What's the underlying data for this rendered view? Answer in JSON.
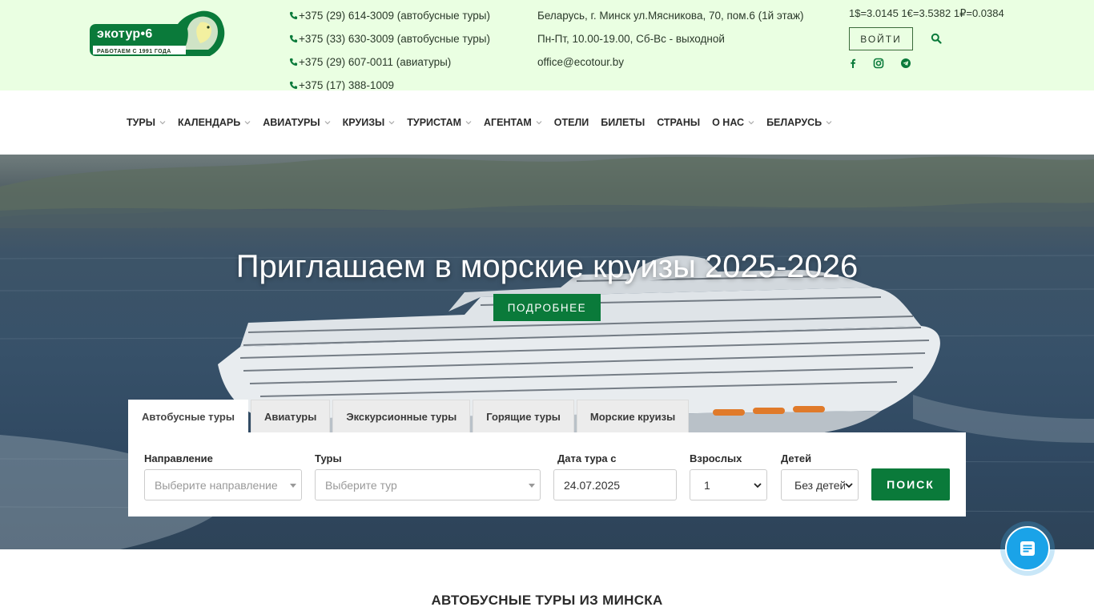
{
  "logo": {
    "name": "экотур•6",
    "slogan": "РАБОТАЕМ С 1991 ГОДА"
  },
  "phones": [
    "+375 (29) 614-3009 (автобусные туры)",
    "+375 (33) 630-3009 (автобусные туры)",
    "+375 (29) 607-0011 (авиатуры)",
    "+375 (17) 388-1009"
  ],
  "contacts": {
    "address": "Беларусь, г. Минск ул.Мясникова, 70, пом.6 (1й этаж)",
    "hours": "Пн-Пт, 10.00-19.00, Сб-Вс - выходной",
    "email": "office@ecotour.by"
  },
  "rates": "1$=3.0145 1€=3.5382 1₽=0.0384",
  "header": {
    "login_label": "ВОЙТИ",
    "icons": [
      "search-icon",
      "facebook-icon",
      "instagram-icon",
      "telegram-icon"
    ]
  },
  "nav": {
    "items": [
      {
        "label": "ТУРЫ",
        "dropdown": true
      },
      {
        "label": "КАЛЕНДАРЬ",
        "dropdown": true
      },
      {
        "label": "АВИАТУРЫ",
        "dropdown": true
      },
      {
        "label": "КРУИЗЫ",
        "dropdown": true
      },
      {
        "label": "ТУРИСТАМ",
        "dropdown": true
      },
      {
        "label": "АГЕНТАМ",
        "dropdown": true
      },
      {
        "label": "ОТЕЛИ",
        "dropdown": false
      },
      {
        "label": "БИЛЕТЫ",
        "dropdown": false
      },
      {
        "label": "СТРАНЫ",
        "dropdown": false
      },
      {
        "label": "О НАС",
        "dropdown": true
      },
      {
        "label": "БЕЛАРУСЬ",
        "dropdown": true
      }
    ]
  },
  "hero": {
    "title": "Приглашаем в морские круизы 2025-2026",
    "button_label": "ПОДРОБНЕЕ"
  },
  "search": {
    "tabs": [
      {
        "label": "Автобусные туры",
        "active": true
      },
      {
        "label": "Авиатуры",
        "active": false
      },
      {
        "label": "Экскурсионные туры",
        "active": false
      },
      {
        "label": "Горящие туры",
        "active": false
      },
      {
        "label": "Морские круизы",
        "active": false
      }
    ],
    "direction": {
      "label": "Направление",
      "placeholder": "Выберите направление"
    },
    "tour": {
      "label": "Туры",
      "placeholder": "Выберите тур"
    },
    "date": {
      "label": "Дата тура с",
      "value": "24.07.2025"
    },
    "adults": {
      "label": "Взрослых",
      "value": "1"
    },
    "children": {
      "label": "Детей",
      "value": "Без детей"
    },
    "submit_label": "ПОИСК"
  },
  "section": {
    "title": "АВТОБУСНЫЕ ТУРЫ ИЗ МИНСКА"
  },
  "colors": {
    "brand_green": "#0a7a3a",
    "topbar_bg": "#eaffe2",
    "chat_blue": "#1aa3e8"
  }
}
